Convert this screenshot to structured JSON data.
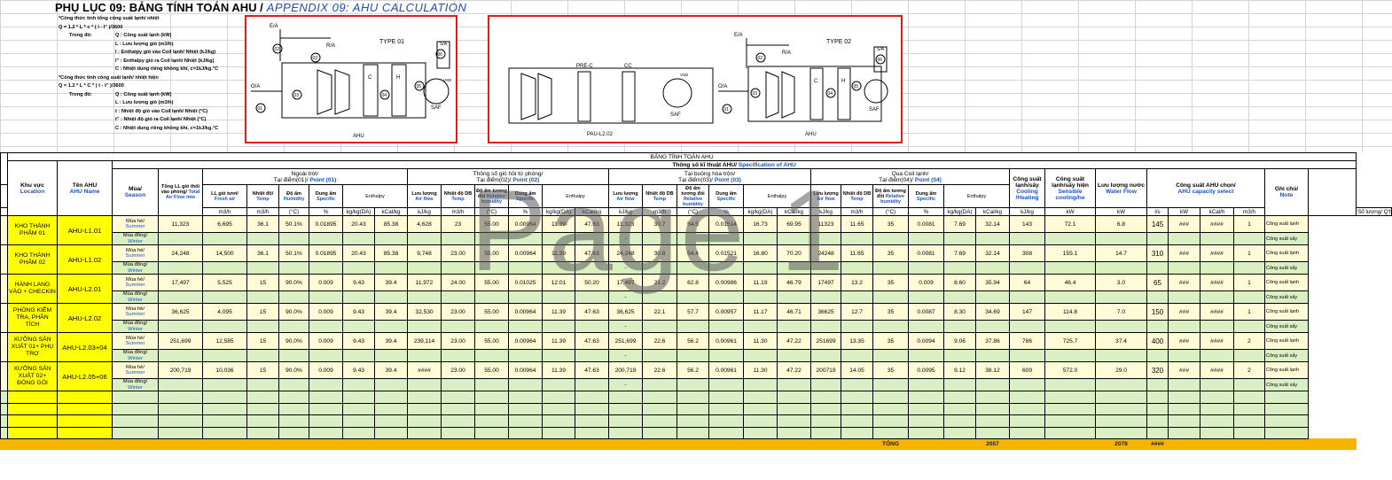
{
  "title": {
    "vi": "PHỤ LỤC 09: BẢNG TÍNH TOÁN AHU /",
    "en": "APPENDIX 09: AHU CALCULATION"
  },
  "formula": {
    "a_head": "*Công thức tính tổng công suất lạnh/ nhiệt",
    "a_eq": "Q = 1.2 * L * c * ( I - I\" )/3600",
    "where": "Trong đó:",
    "a_lines": [
      [
        "Q :",
        "Công suất lạnh (kW)"
      ],
      [
        "L :",
        "Lưu lượng gió (m3/h)"
      ],
      [
        "I :",
        "Enthalpy gió vào Coil lạnh/ Nhiệt (kJ/kg)"
      ],
      [
        "I\" :",
        "Enthalpy gió ra Coil lạnh/ Nhiệt (kJ/kg)"
      ],
      [
        "C :",
        "Nhiệt dung riêng không khí, c=1kJ/kg.°C"
      ]
    ],
    "b_head": "*Công thức tính công suất lạnh/ nhiệt hiện",
    "b_eq": "Q = 1.2 * L * C * ( t - t\" )/3600",
    "b_lines": [
      [
        "Q :",
        "Công suất lạnh (kW)"
      ],
      [
        "L :",
        "Lưu lượng gió (m3/h)"
      ],
      [
        "t :",
        "Nhiệt độ gió vào Coil lạnh/ Nhiệt (°C)"
      ],
      [
        "t\" :",
        "Nhiệt độ gió ra Coil lạnh/ Nhiệt (°C)"
      ],
      [
        "C :",
        "Nhiệt dung riêng không khí, c=1kJ/kg.°C"
      ]
    ]
  },
  "fig1": {
    "type": "TYPE 01",
    "ea": "E/A",
    "ra": "R/A",
    "oa": "O/A",
    "sa": "S/A",
    "saf": "SAF",
    "vsd": "VSD",
    "ahu": "AHU",
    "c": "C",
    "h": "H",
    "p01": "01",
    "p02": "02",
    "p03": "03",
    "p04": "04",
    "p05": "05",
    "p06": "06"
  },
  "fig2": {
    "prec": "PRE-C",
    "cc": "CC",
    "pau": "PAU-L2.02",
    "vsd": "VSD",
    "saf": "SAF",
    "type": "TYPE 02",
    "ea": "E/A",
    "ra": "R/A",
    "oa": "O/A",
    "sa": "S/A",
    "ahu": "AHU",
    "c": "C",
    "h": "H",
    "p01": "01",
    "p02": "02",
    "p03": "03",
    "p04": "04",
    "p05": "05",
    "p06": "06"
  },
  "watermark": "Page 1",
  "header": {
    "main": "BẢNG TÍNH TOÁN AHU",
    "spec_vi": "Thông số kĩ thuật AHU/",
    "spec_en": "Specification of AHU",
    "loc_vi": "Khu vực",
    "loc_en": "Location",
    "name_vi": "Tên AHU",
    "name_en": "AHU Name",
    "season_vi": "Mùa/",
    "season_en": "Season",
    "outdoor": "Ngoài trời/",
    "p01_vi": "Tại điểm(01)/",
    "p01_en": "Point (01)",
    "return": "Thông số gió hồi từ phòng/",
    "p02_vi": "Tại điểm(02)/",
    "p02_en": "Point (02)",
    "mix": "Tại buồng hòa trộn/",
    "p03_vi": "Tại điểm(03)/",
    "p03_en": "Point (03)",
    "coil": "Qua Coil lạnh/",
    "p04_vi": "Tại điểm(04)/",
    "p04_en": "Point (04)",
    "total_air_vi": "Tổng LL gió thổi vào phòng/",
    "total_air_en": "Total Air Flow into",
    "fresh_vi": "LL gió tươi/",
    "fresh_en": "Fresh air",
    "temp_vi": "Nhiệt độ/",
    "temp_en": "Temp",
    "hum_vi": "Độ ẩm",
    "hum_en": "Humidity",
    "spec_h_vi": "Dung ẩm",
    "spec_h_en": "Specific",
    "enthalpy": "Enthalpy",
    "flow_vi": "Lưu lượng",
    "flow_en": "Air flow",
    "db_vi": "Nhiệt độ DB",
    "db_en": "Temp",
    "rh_vi": "Độ ẩm tương đối",
    "rh_en": "Relative humidity",
    "cool_vi": "Công suất lạnh/sấy",
    "cool_en": "Cooling /Heating",
    "sens_vi": "Công suất lạnh/sấy hiện",
    "sens_en": "Sensible cooling/he",
    "water_vi": "Lưu lượng nước",
    "water_en": "Water Flow",
    "cap_vi": "Công suất AHU chọn/",
    "cap_en": "AHU capacity select",
    "note_vi": "Ghi chú/",
    "note_en": "Note"
  },
  "units": [
    "m3/h",
    "m3/h",
    "(°C)",
    "%",
    "kg/kg(DA)",
    "kCal/kg",
    "kJ/kg",
    "m3/h",
    "(°C)",
    "%",
    "kg/kg(DA)",
    "kCal/kg",
    "kJ/kg",
    "m3/h",
    "(°C)",
    "%",
    "kg/kg(DA)",
    "kCal/kg",
    "kJ/kg",
    "m3/h",
    "(°C)",
    "%",
    "kg/kg(DA)",
    "kCal/kg",
    "kJ/kg",
    "kW",
    "kW",
    "l/s",
    "kW",
    "kCal/h",
    "m3/h",
    "Số lượng/ Q'ty"
  ],
  "summer": {
    "vi": "Mùa hè/",
    "en": "Summer"
  },
  "winter": {
    "vi": "Mùa đông/",
    "en": "Winter"
  },
  "rows": [
    {
      "loc": "KHO THÀNH PHẨM 01",
      "name": "AHU-L1.01",
      "v": [
        "11,323",
        "6,695",
        "36.1",
        "50.1%",
        "0.01895",
        "20.43",
        "85.38",
        "4,628",
        "23",
        "55.00",
        "0.00964",
        "11.39",
        "47.63",
        "11,323",
        "30.7",
        "54.5",
        "0.01514",
        "16.73",
        "69.95",
        "11323",
        "11.65",
        "35",
        "0.0081",
        "7.69",
        "32.14",
        "143",
        "72.1",
        "6.8",
        "145",
        "###",
        "####",
        "1",
        "Công suất lạnh"
      ],
      "w": "-",
      "wnote": "Công suất sấy"
    },
    {
      "loc": "KHO THÀNH PHẨM 02",
      "name": "AHU-L1.02",
      "v": [
        "24,248",
        "14,500",
        "36.1",
        "50.1%",
        "0.01895",
        "20.43",
        "85.38",
        "9,748",
        "23.00",
        "55.00",
        "0.00964",
        "11.39",
        "47.63",
        "24,248",
        "30.8",
        "54.4",
        "0.01521",
        "16.80",
        "70.20",
        "24248",
        "11.65",
        "35",
        "0.0081",
        "7.69",
        "32.14",
        "308",
        "155.1",
        "14.7",
        "310",
        "###",
        "####",
        "1",
        "Công suất lạnh"
      ],
      "w": "-",
      "wnote": "Công suất sấy"
    },
    {
      "loc": "HÀNH LANG VÀO + CHECKIN",
      "name": "AHU-L2.01",
      "v": [
        "17,497",
        "5,525",
        "15",
        "90.0%",
        "0.009",
        "9.43",
        "39.4",
        "11,972",
        "24.00",
        "55.00",
        "0.01025",
        "12.01",
        "50.20",
        "17,497",
        "21.2",
        "62.8",
        "0.00986",
        "11.19",
        "46.79",
        "17497",
        "13.2",
        "35",
        "0.009",
        "8.60",
        "35.94",
        "64",
        "46.4",
        "3.0",
        "65",
        "###",
        "####",
        "1",
        "Công suất lạnh"
      ],
      "w": "-",
      "wnote": "Công suất sấy"
    },
    {
      "loc": "PHÒNG KIỂM TRA, PHÂN TÍCH",
      "name": "AHU-L2.02",
      "v": [
        "36,625",
        "4,095",
        "15",
        "90.0%",
        "0.009",
        "9.43",
        "39.4",
        "32,530",
        "23.00",
        "55.00",
        "0.00964",
        "11.39",
        "47.63",
        "36,625",
        "22.1",
        "57.7",
        "0.00957",
        "11.17",
        "46.71",
        "36625",
        "12.7",
        "35",
        "0.0087",
        "8.30",
        "34.69",
        "147",
        "114.8",
        "7.0",
        "150",
        "###",
        "####",
        "1",
        "Công suất lạnh"
      ],
      "w": "-",
      "wnote": "Công suất sấy"
    },
    {
      "loc": "XƯỞNG SẢN XUẤT 01+ PHỤ TRỢ",
      "name": "AHU-L2.03+04",
      "v": [
        "251,699",
        "12,585",
        "15",
        "90.0%",
        "0.009",
        "9.43",
        "39.4",
        "239,114",
        "23.00",
        "55.00",
        "0.00964",
        "11.39",
        "47.63",
        "251,699",
        "22.6",
        "56.2",
        "0.00961",
        "11.30",
        "47.22",
        "251699",
        "13.35",
        "35",
        "0.0094",
        "9.06",
        "37.86",
        "786",
        "725.7",
        "37.4",
        "400",
        "###",
        "####",
        "2",
        "Công suất lạnh"
      ],
      "w": "-",
      "wnote": "Công suất sấy"
    },
    {
      "loc": "XƯỞNG SẢN XUẤT 02+ ĐÓNG GÓI",
      "name": "AHU-L2.05+06",
      "v": [
        "200,719",
        "10,036",
        "15",
        "90.0%",
        "0.009",
        "9.43",
        "39.4",
        "####",
        "23.00",
        "55.00",
        "0.00964",
        "11.39",
        "47.63",
        "200,719",
        "22.6",
        "56.2",
        "0.00961",
        "11.30",
        "47.22",
        "200719",
        "14.05",
        "35",
        "0.0095",
        "9.12",
        "38.12",
        "609",
        "572.0",
        "29.0",
        "320",
        "###",
        "####",
        "2",
        "Công suất lạnh"
      ],
      "w": "-",
      "wnote": "Công suất sấy"
    }
  ],
  "total": {
    "label": "TỔNG",
    "cool": "2057",
    "cap": "2078",
    "h": "####"
  }
}
